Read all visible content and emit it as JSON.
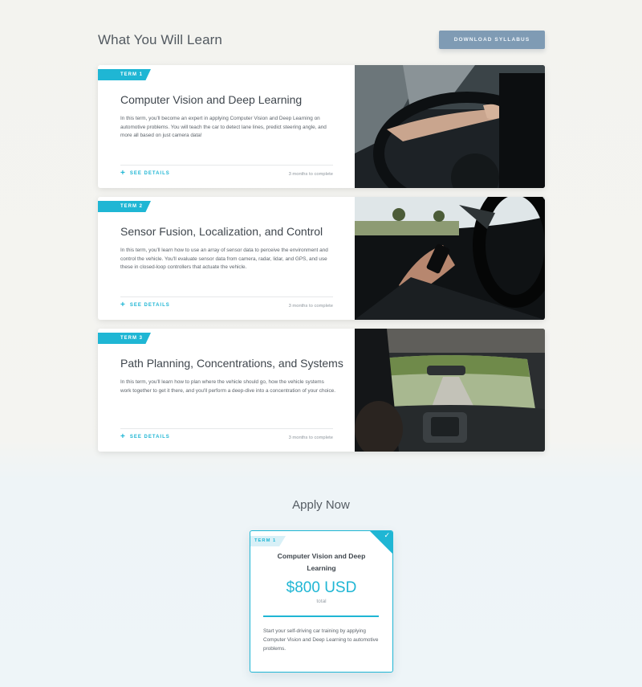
{
  "learn": {
    "title": "What You Will Learn",
    "download_label": "DOWNLOAD SYLLABUS"
  },
  "terms": [
    {
      "badge": "TERM 1",
      "title": "Computer Vision and Deep Learning",
      "description": "In this term, you'll become an expert in applying Computer Vision and Deep Learning on automotive problems. You will teach the car to detect lane lines, predict steering angle, and more all based on just camera data!",
      "details_label": "SEE DETAILS",
      "duration": "3 months to complete"
    },
    {
      "badge": "TERM 2",
      "title": "Sensor Fusion, Localization, and Control",
      "description": "In this term, you'll learn how to use an array of sensor data to perceive the environment and control the vehicle. You'll evaluate sensor data from camera, radar, lidar, and GPS, and use these in closed-loop controllers that actuate the vehicle.",
      "details_label": "SEE DETAILS",
      "duration": "3 months to complete"
    },
    {
      "badge": "TERM 3",
      "title": "Path Planning, Concentrations, and Systems",
      "description": "In this term, you'll learn how to plan where the vehicle should go, how the vehicle systems work together to get it there, and you'll perform a deep-dive into a concentration of your choice.",
      "details_label": "SEE DETAILS",
      "duration": "3 months to complete"
    }
  ],
  "apply": {
    "title": "Apply Now",
    "badge": "TERM 1",
    "course": "Computer Vision and Deep Learning",
    "price": "$800 USD",
    "price_note": "total",
    "description": "Start your self-driving car training by applying Computer Vision and Deep Learning to automotive problems.",
    "check_icon": "✓"
  },
  "colors": {
    "accent": "#1fb6d4",
    "button": "#7f9bb4"
  }
}
